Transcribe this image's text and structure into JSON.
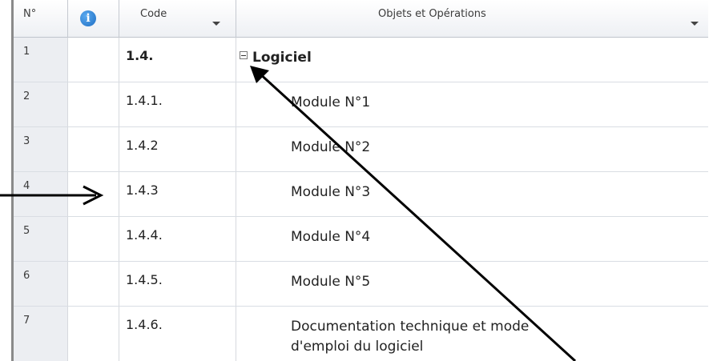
{
  "header": {
    "num_label": "N°",
    "info_icon": "info-icon",
    "code_label": "Code",
    "objects_label": "Objets et Opérations"
  },
  "rows": [
    {
      "num": "1",
      "code": "1.4.",
      "label": "Logiciel",
      "root": true
    },
    {
      "num": "2",
      "code": "1.4.1.",
      "label": "Module N°1"
    },
    {
      "num": "3",
      "code": "1.4.2",
      "label": "Module N°2"
    },
    {
      "num": "4",
      "code": "1.4.3",
      "label": "Module N°3"
    },
    {
      "num": "5",
      "code": "1.4.4.",
      "label": "Module N°4"
    },
    {
      "num": "6",
      "code": "1.4.5.",
      "label": "Module N°5"
    },
    {
      "num": "7",
      "code": "1.4.6.",
      "label_line1": "Documentation technique et mode",
      "label_line2": "d'emploi du logiciel"
    }
  ],
  "annotations": {
    "pointer_arrow": "arrow pointing to row 4",
    "diagonal_arrow": "arrow pointing to collapse toggle of row 1",
    "color": "#000000"
  },
  "colors": {
    "header_bg": "#eef0f4",
    "number_col_bg": "#eceef2",
    "info_icon": "#1f6fc4"
  }
}
